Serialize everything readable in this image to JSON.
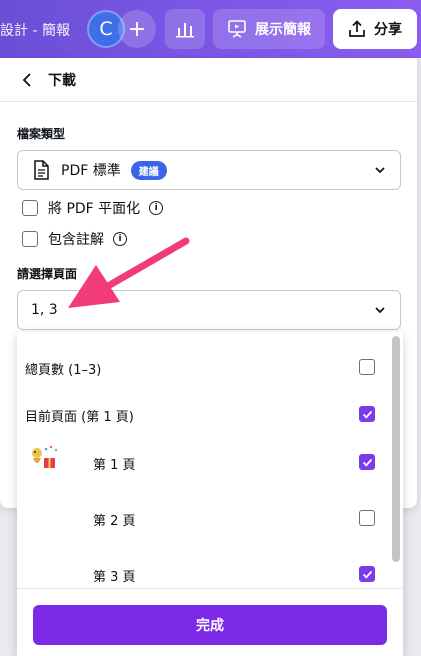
{
  "topbar": {
    "doc_title": "設計 - 簡報",
    "avatar_initial": "C",
    "add_label": "+",
    "present_label": "展示簡報",
    "share_label": "分享"
  },
  "panel": {
    "title": "下載",
    "file_type_label": "檔案類型",
    "file_type_value": "PDF 標準",
    "file_type_badge": "建議",
    "flatten_label": "將 PDF 平面化",
    "comments_label": "包含註解",
    "info_glyph": "i",
    "pages_label": "請選擇頁面",
    "pages_value": "1, 3"
  },
  "dropdown": {
    "items": [
      {
        "label": "總頁數 (1–3)",
        "checked": false
      },
      {
        "label": "目前頁面 (第 1 頁)",
        "checked": true
      },
      {
        "label": "第 1 頁",
        "checked": true
      },
      {
        "label": "第 2 頁",
        "checked": false
      },
      {
        "label": "第 3 頁",
        "checked": true
      }
    ],
    "done_label": "完成"
  },
  "colors": {
    "accent": "#7d2ae8",
    "annotation_arrow": "#f23c78"
  }
}
